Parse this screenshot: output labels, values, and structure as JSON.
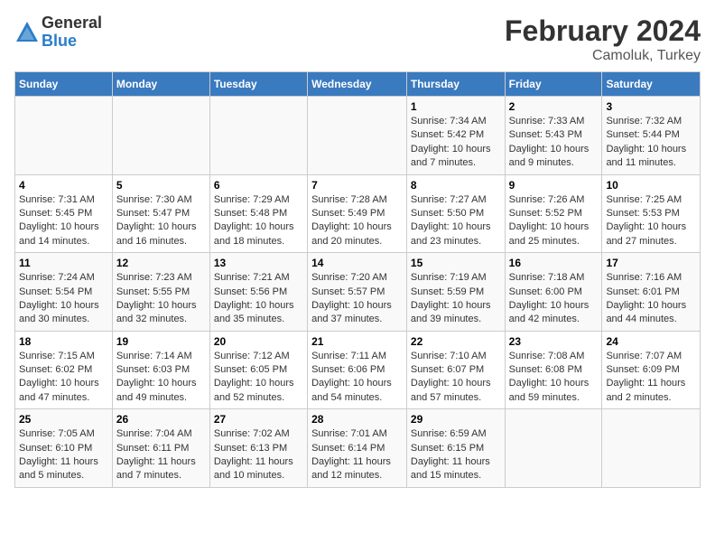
{
  "logo": {
    "general": "General",
    "blue": "Blue"
  },
  "header": {
    "title": "February 2024",
    "subtitle": "Camoluk, Turkey"
  },
  "weekdays": [
    "Sunday",
    "Monday",
    "Tuesday",
    "Wednesday",
    "Thursday",
    "Friday",
    "Saturday"
  ],
  "weeks": [
    [
      {
        "day": "",
        "info": ""
      },
      {
        "day": "",
        "info": ""
      },
      {
        "day": "",
        "info": ""
      },
      {
        "day": "",
        "info": ""
      },
      {
        "day": "1",
        "info": "Sunrise: 7:34 AM\nSunset: 5:42 PM\nDaylight: 10 hours\nand 7 minutes."
      },
      {
        "day": "2",
        "info": "Sunrise: 7:33 AM\nSunset: 5:43 PM\nDaylight: 10 hours\nand 9 minutes."
      },
      {
        "day": "3",
        "info": "Sunrise: 7:32 AM\nSunset: 5:44 PM\nDaylight: 10 hours\nand 11 minutes."
      }
    ],
    [
      {
        "day": "4",
        "info": "Sunrise: 7:31 AM\nSunset: 5:45 PM\nDaylight: 10 hours\nand 14 minutes."
      },
      {
        "day": "5",
        "info": "Sunrise: 7:30 AM\nSunset: 5:47 PM\nDaylight: 10 hours\nand 16 minutes."
      },
      {
        "day": "6",
        "info": "Sunrise: 7:29 AM\nSunset: 5:48 PM\nDaylight: 10 hours\nand 18 minutes."
      },
      {
        "day": "7",
        "info": "Sunrise: 7:28 AM\nSunset: 5:49 PM\nDaylight: 10 hours\nand 20 minutes."
      },
      {
        "day": "8",
        "info": "Sunrise: 7:27 AM\nSunset: 5:50 PM\nDaylight: 10 hours\nand 23 minutes."
      },
      {
        "day": "9",
        "info": "Sunrise: 7:26 AM\nSunset: 5:52 PM\nDaylight: 10 hours\nand 25 minutes."
      },
      {
        "day": "10",
        "info": "Sunrise: 7:25 AM\nSunset: 5:53 PM\nDaylight: 10 hours\nand 27 minutes."
      }
    ],
    [
      {
        "day": "11",
        "info": "Sunrise: 7:24 AM\nSunset: 5:54 PM\nDaylight: 10 hours\nand 30 minutes."
      },
      {
        "day": "12",
        "info": "Sunrise: 7:23 AM\nSunset: 5:55 PM\nDaylight: 10 hours\nand 32 minutes."
      },
      {
        "day": "13",
        "info": "Sunrise: 7:21 AM\nSunset: 5:56 PM\nDaylight: 10 hours\nand 35 minutes."
      },
      {
        "day": "14",
        "info": "Sunrise: 7:20 AM\nSunset: 5:57 PM\nDaylight: 10 hours\nand 37 minutes."
      },
      {
        "day": "15",
        "info": "Sunrise: 7:19 AM\nSunset: 5:59 PM\nDaylight: 10 hours\nand 39 minutes."
      },
      {
        "day": "16",
        "info": "Sunrise: 7:18 AM\nSunset: 6:00 PM\nDaylight: 10 hours\nand 42 minutes."
      },
      {
        "day": "17",
        "info": "Sunrise: 7:16 AM\nSunset: 6:01 PM\nDaylight: 10 hours\nand 44 minutes."
      }
    ],
    [
      {
        "day": "18",
        "info": "Sunrise: 7:15 AM\nSunset: 6:02 PM\nDaylight: 10 hours\nand 47 minutes."
      },
      {
        "day": "19",
        "info": "Sunrise: 7:14 AM\nSunset: 6:03 PM\nDaylight: 10 hours\nand 49 minutes."
      },
      {
        "day": "20",
        "info": "Sunrise: 7:12 AM\nSunset: 6:05 PM\nDaylight: 10 hours\nand 52 minutes."
      },
      {
        "day": "21",
        "info": "Sunrise: 7:11 AM\nSunset: 6:06 PM\nDaylight: 10 hours\nand 54 minutes."
      },
      {
        "day": "22",
        "info": "Sunrise: 7:10 AM\nSunset: 6:07 PM\nDaylight: 10 hours\nand 57 minutes."
      },
      {
        "day": "23",
        "info": "Sunrise: 7:08 AM\nSunset: 6:08 PM\nDaylight: 10 hours\nand 59 minutes."
      },
      {
        "day": "24",
        "info": "Sunrise: 7:07 AM\nSunset: 6:09 PM\nDaylight: 11 hours\nand 2 minutes."
      }
    ],
    [
      {
        "day": "25",
        "info": "Sunrise: 7:05 AM\nSunset: 6:10 PM\nDaylight: 11 hours\nand 5 minutes."
      },
      {
        "day": "26",
        "info": "Sunrise: 7:04 AM\nSunset: 6:11 PM\nDaylight: 11 hours\nand 7 minutes."
      },
      {
        "day": "27",
        "info": "Sunrise: 7:02 AM\nSunset: 6:13 PM\nDaylight: 11 hours\nand 10 minutes."
      },
      {
        "day": "28",
        "info": "Sunrise: 7:01 AM\nSunset: 6:14 PM\nDaylight: 11 hours\nand 12 minutes."
      },
      {
        "day": "29",
        "info": "Sunrise: 6:59 AM\nSunset: 6:15 PM\nDaylight: 11 hours\nand 15 minutes."
      },
      {
        "day": "",
        "info": ""
      },
      {
        "day": "",
        "info": ""
      }
    ]
  ]
}
